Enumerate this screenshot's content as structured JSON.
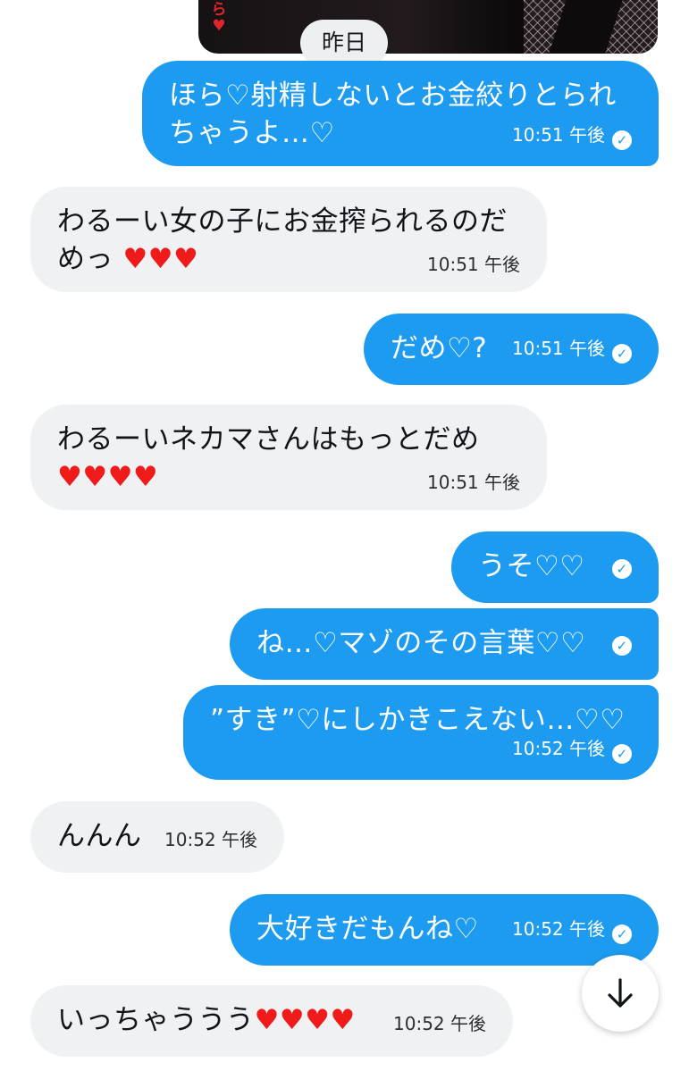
{
  "date_separator": "昨日",
  "messages": [
    {
      "dir": "out",
      "text_l1": "ほら♡射精しないとお金絞りとられ",
      "text_l2": "ちゃうよ…♡",
      "time": "10:51 午後"
    },
    {
      "dir": "in",
      "text_l1": "わるーい女の子にお金搾られるのだ",
      "text_l2": "めっ",
      "hearts": "♥♥♥",
      "time": "10:51 午後"
    },
    {
      "dir": "out",
      "text": "だめ♡?",
      "time": "10:51 午後"
    },
    {
      "dir": "in",
      "text_l1": "わるーいネカマさんはもっとだめ",
      "hearts": "♥♥♥♥",
      "time": "10:51 午後"
    },
    {
      "dir": "out",
      "text": "うそ♡♡"
    },
    {
      "dir": "out",
      "text": "ね…♡マゾのその言葉♡♡"
    },
    {
      "dir": "out",
      "text": "”すき”♡にしかきこえない…♡♡",
      "time": "10:52 午後"
    },
    {
      "dir": "in",
      "text": "んんん",
      "time": "10:52 午後"
    },
    {
      "dir": "out",
      "text": "大好きだもんね♡",
      "time": "10:52 午後"
    },
    {
      "dir": "in",
      "text": "いっちゃううう",
      "hearts": "♥♥♥♥",
      "time": "10:52 午後"
    }
  ],
  "colors": {
    "outgoing": "#1d9bf0",
    "incoming": "#eff1f3",
    "heart": "#ef1b1b"
  },
  "icons": {
    "read_receipt": "check-circle-icon",
    "scroll_down": "arrow-down-icon"
  }
}
